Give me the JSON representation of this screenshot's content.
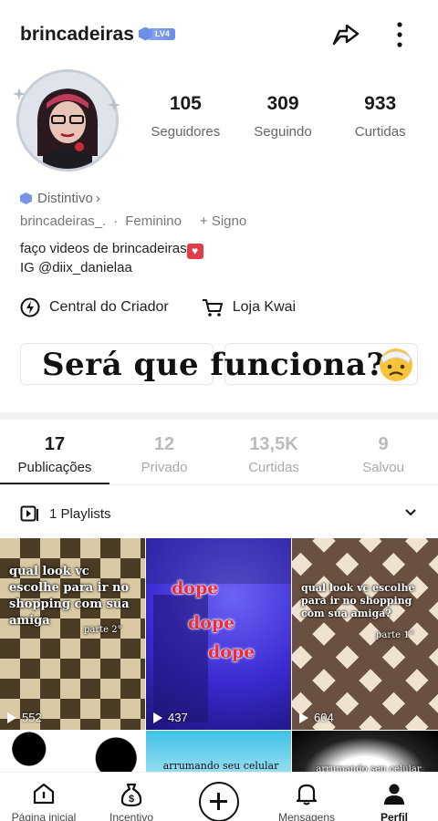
{
  "header": {
    "username": "brincadeiras",
    "level_badge": "LV4"
  },
  "stats": [
    {
      "value": "105",
      "label": "Seguidores"
    },
    {
      "value": "309",
      "label": "Seguindo"
    },
    {
      "value": "933",
      "label": "Curtidas"
    }
  ],
  "profile": {
    "badge_label": "Distintivo",
    "badge_chevron": "›",
    "handle": "brincadeiras_.",
    "separator": "·",
    "gender": "Feminino",
    "sign": "+ Signo",
    "bio_line1": "faço videos de brincadeiras",
    "bio_line2": "IG @diix_danielaa"
  },
  "creator_links": {
    "central": "Central do Criador",
    "loja": "Loja Kwai"
  },
  "overlay_caption": "Será que  funciona?",
  "content_tabs": [
    {
      "value": "17",
      "label": "Publicações",
      "active": true
    },
    {
      "value": "12",
      "label": "Privado",
      "active": false
    },
    {
      "value": "13,5K",
      "label": "Curtidas",
      "active": false
    },
    {
      "value": "9",
      "label": "Salvou",
      "active": false
    }
  ],
  "playlists_label": "1 Playlists",
  "videos": [
    {
      "caption": "qual look vc escolhe para ir no shopping com sua amiga",
      "part": "parte 2°",
      "views": "552"
    },
    {
      "caption": "dope",
      "views": "437"
    },
    {
      "caption": "qual look vc escolhe para ir no shopping com sua amiga?",
      "part": "parte 1°",
      "views": "604"
    },
    {
      "caption": ""
    },
    {
      "caption": "arrumando seu celular"
    },
    {
      "caption": "arrumando seu celular"
    }
  ],
  "bottom_nav": [
    {
      "label": "Página inicial",
      "icon": "home-icon"
    },
    {
      "label": "Incentivo",
      "icon": "money-bag-icon"
    },
    {
      "label": "",
      "icon": "plus-icon"
    },
    {
      "label": "Mensagens",
      "icon": "bell-icon"
    },
    {
      "label": "Perfil",
      "icon": "person-icon",
      "active": true
    }
  ],
  "colors": {
    "accent_badge": "#6f8ee8",
    "text_primary": "#1a1a1a",
    "text_secondary": "#666666",
    "dope_red": "#e82a3c"
  }
}
